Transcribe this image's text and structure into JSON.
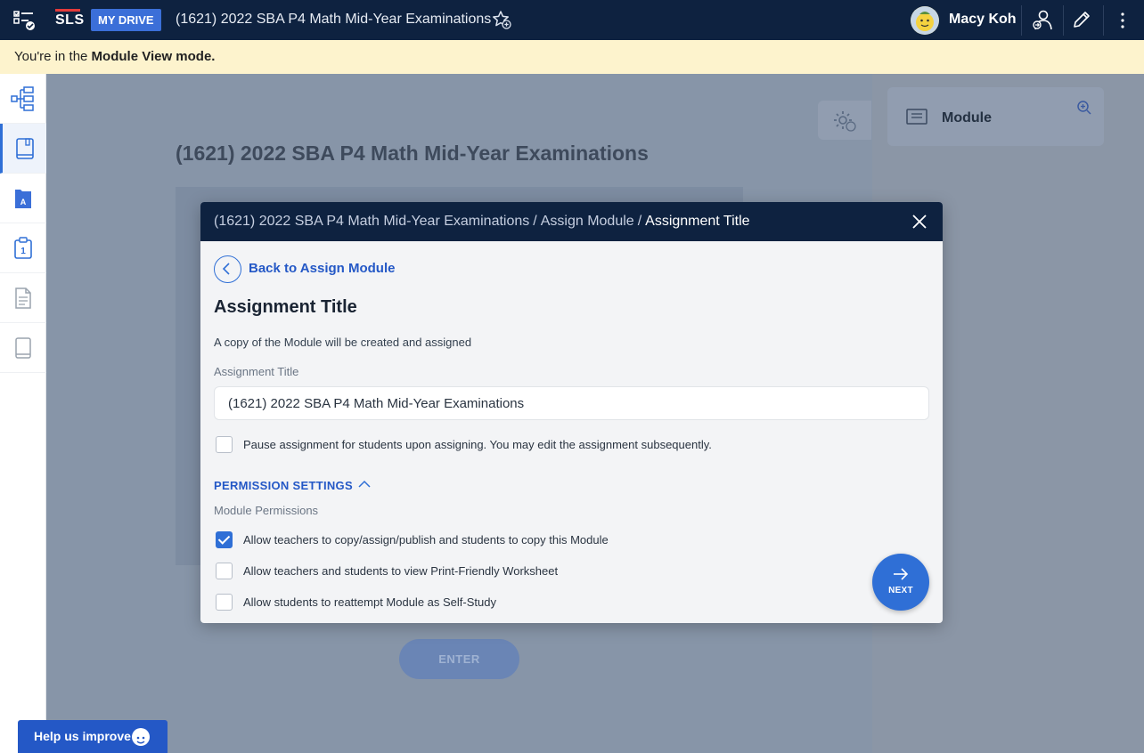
{
  "topbar": {
    "logo": "SLS",
    "drive_label": "MY DRIVE",
    "title": "(1621) 2022 SBA P4 Math Mid-Year Examinations",
    "user_name": "Macy Koh"
  },
  "notice": {
    "prefix": "You're in the ",
    "mode": "Module View mode."
  },
  "background": {
    "module_title": "(1621) 2022 SBA P4 Math Mid-Year Examinations",
    "enter_label": "ENTER",
    "module_card_label": "Module"
  },
  "help": {
    "label": "Help us improve"
  },
  "modal": {
    "breadcrumbs": [
      "(1621) 2022 SBA P4 Math Mid-Year Examinations",
      "Assign Module",
      "Assignment Title"
    ],
    "breadcrumb_separator": "/",
    "back_label": "Back to Assign Module",
    "heading": "Assignment Title",
    "subtitle": "A copy of the Module will be created and assigned",
    "field_label": "Assignment Title",
    "field_value": "(1621) 2022 SBA P4 Math Mid-Year Examinations",
    "pause_option": {
      "label": "Pause assignment for students upon assigning. You may edit the assignment subsequently.",
      "checked": false
    },
    "permission_heading": "PERMISSION SETTINGS",
    "permission_subheading": "Module Permissions",
    "permissions": [
      {
        "label": "Allow teachers to copy/assign/publish and students to copy this Module",
        "checked": true
      },
      {
        "label": "Allow teachers and students to view Print-Friendly Worksheet",
        "checked": false
      },
      {
        "label": "Allow students to reattempt Module as Self-Study",
        "checked": false
      }
    ],
    "next_label": "NEXT"
  },
  "colors": {
    "navy": "#0e2240",
    "accent": "#2f6fd6",
    "notice_bg": "#fdf3cd"
  },
  "icons": {
    "rail": [
      "module-tree-icon",
      "module-book-icon",
      "assessment-a-icon",
      "clipboard-1-icon",
      "document-icon",
      "notebook-icon"
    ]
  }
}
